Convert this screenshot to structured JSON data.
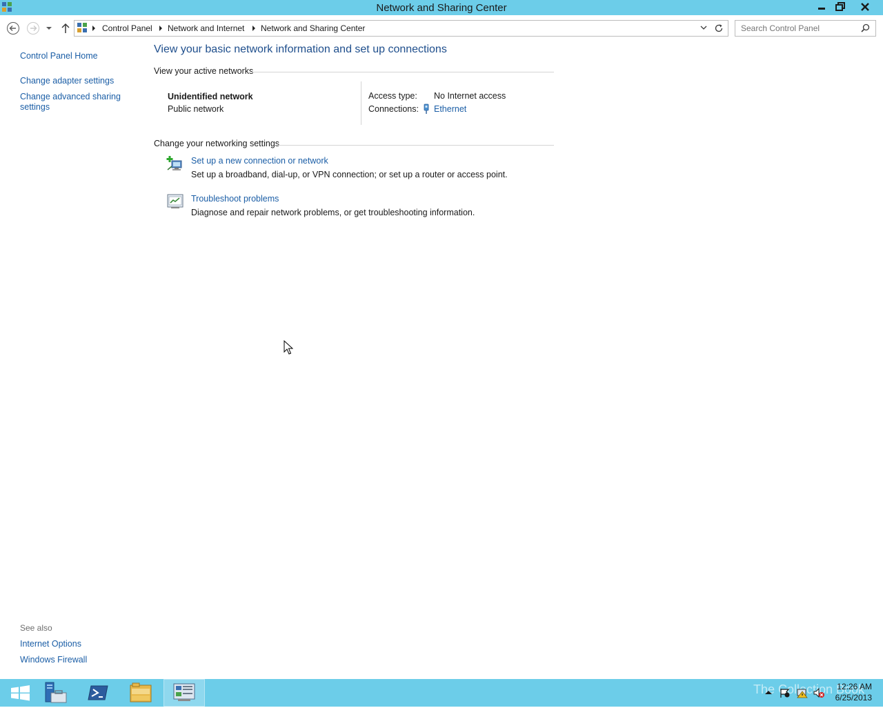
{
  "window": {
    "title": "Network and Sharing Center"
  },
  "address": {
    "crumbs": [
      "Control Panel",
      "Network and Internet",
      "Network and Sharing Center"
    ]
  },
  "search": {
    "placeholder": "Search Control Panel"
  },
  "sidebar": {
    "home": "Control Panel Home",
    "items": [
      "Change adapter settings",
      "Change advanced sharing settings"
    ],
    "see_also_label": "See also",
    "see_also": [
      "Internet Options",
      "Windows Firewall"
    ]
  },
  "main": {
    "heading": "View your basic network information and set up connections",
    "active_label": "View your active networks",
    "network": {
      "name": "Unidentified network",
      "type": "Public network",
      "access_label": "Access type:",
      "access_value": "No Internet access",
      "connections_label": "Connections:",
      "connection_value": "Ethernet"
    },
    "change_label": "Change your networking settings",
    "tasks": [
      {
        "title": "Set up a new connection or network",
        "desc": "Set up a broadband, dial-up, or VPN connection; or set up a router or access point."
      },
      {
        "title": "Troubleshoot problems",
        "desc": "Diagnose and repair network problems, or get troubleshooting information."
      }
    ]
  },
  "taskbar": {
    "time": "12:26 AM",
    "date": "6/25/2013",
    "watermark": "The Collection Book"
  },
  "colors": {
    "chrome": "#6ccde9",
    "link": "#1b5ea6",
    "heading": "#1e4e8c"
  }
}
